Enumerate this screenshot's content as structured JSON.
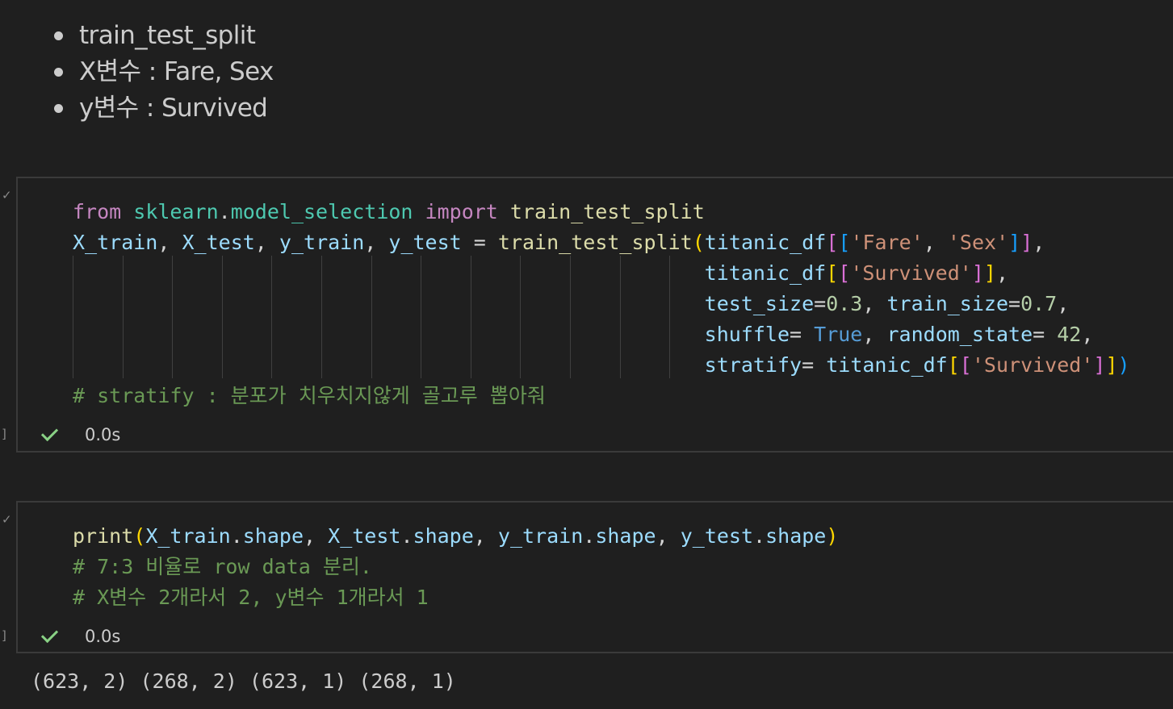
{
  "markdown": {
    "items": [
      {
        "label": "train_test_split"
      },
      {
        "label": "X변수 : Fare, Sex"
      },
      {
        "label": "y변수 : Survived"
      }
    ]
  },
  "cells": [
    {
      "execution_bracket": "]",
      "status_text": "0.0s",
      "code_lines": [
        "from sklearn.model_selection import train_test_split",
        "X_train, X_test, y_train, y_test = train_test_split(titanic_df[['Fare', 'Sex']],",
        "                                                    titanic_df[['Survived']],",
        "                                                    test_size=0.3, train_size=0.7,",
        "                                                    shuffle= True, random_state= 42,",
        "                                                    stratify= titanic_df[['Survived']])",
        "# stratify : 분포가 치우치지않게 골고루 뽑아줘"
      ]
    },
    {
      "execution_bracket": "]",
      "status_text": "0.0s",
      "code_lines": [
        "print(X_train.shape, X_test.shape, y_train.shape, y_test.shape)",
        "# 7:3 비율로 row data 분리.",
        "# X변수 2개라서 2, y변수 1개라서 1"
      ]
    }
  ],
  "output": {
    "text": "(623, 2) (268, 2) (623, 1) (268, 1)"
  },
  "colors": {
    "background": "#1f1f1f",
    "keyword": "#c586c0",
    "module": "#4ec9b0",
    "function": "#dcdcaa",
    "variable": "#9cdcfe",
    "string": "#ce9178",
    "number": "#b5cea8",
    "comment": "#6a9955",
    "success_check": "#89d185"
  },
  "icons": {
    "status": "check-icon"
  }
}
